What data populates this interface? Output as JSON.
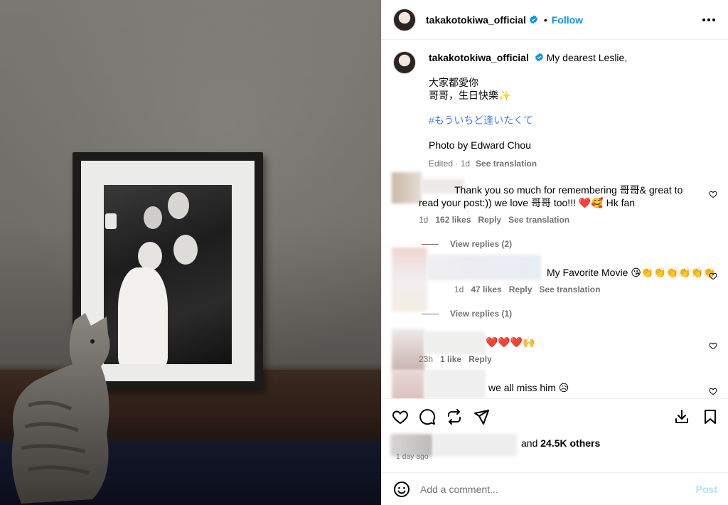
{
  "header": {
    "username": "takakotokiwa_official",
    "separator": "•",
    "follow_label": "Follow"
  },
  "caption": {
    "username": "takakotokiwa_official",
    "line1": "My dearest Leslie,",
    "line2": "大家都愛你",
    "line3": "哥哥，生日快樂✨",
    "hashtag": "#もういちど逢いたくて",
    "credit": "Photo by Edward Chou",
    "edited": "Edited · 1d",
    "see_translation": "See translation"
  },
  "comments": [
    {
      "text": "Thank you so much for remembering 哥哥& great to read your post:)) we love 哥哥 too!!! ❤️🥰 Hk fan",
      "line_a": "Thank you so much for remembering 哥哥& great to",
      "line_b": "read your post:)) we love 哥哥 too!!! ❤️🥰 Hk fan",
      "time": "1d",
      "likes": "162 likes",
      "reply": "Reply",
      "translate": "See translation",
      "view_replies": "View replies (2)"
    },
    {
      "text": "My Favorite Movie 😘👏👏👏👏👏👏",
      "time": "1d",
      "likes": "47 likes",
      "reply": "Reply",
      "translate": "See translation",
      "view_replies": "View replies (1)"
    },
    {
      "text": "❤️❤️❤️🙌",
      "time": "23h",
      "likes": "1 like",
      "reply": "Reply"
    },
    {
      "text": "we all miss him 😥"
    }
  ],
  "likes_summary": {
    "prefix": "and",
    "count": "24.5K others"
  },
  "posted_ago": "1 day ago",
  "add_comment": {
    "placeholder": "Add a comment...",
    "post_label": "Post"
  },
  "colors": {
    "accent": "#0095f6",
    "hashtag": "#4a7ce8",
    "muted": "#737373",
    "post_disabled": "#b2dffc",
    "heart_red": "#e0241b"
  },
  "icons": [
    "verified-badge-icon",
    "more-options-icon",
    "heart-icon",
    "comment-icon",
    "share-icon",
    "send-icon",
    "save-icon",
    "bookmark-icon",
    "emoji-icon"
  ]
}
